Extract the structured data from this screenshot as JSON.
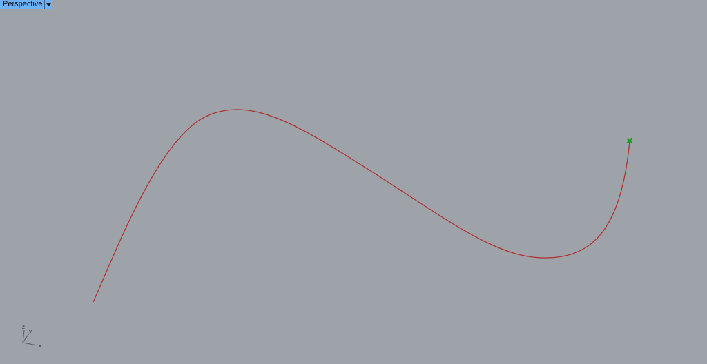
{
  "viewport": {
    "title": "Perspective",
    "dropdown_icon": "triangle-down-icon",
    "background_color": "#9ea3aa",
    "tab_color": "#6fb1f5"
  },
  "scene": {
    "curve": {
      "color": "#b03030"
    },
    "endpoint_marker": {
      "icon": "cross-marker-icon",
      "color": "#1f9e1f"
    }
  },
  "axes_widget": {
    "x_label": "x",
    "y_label": "y",
    "z_label": "z"
  }
}
